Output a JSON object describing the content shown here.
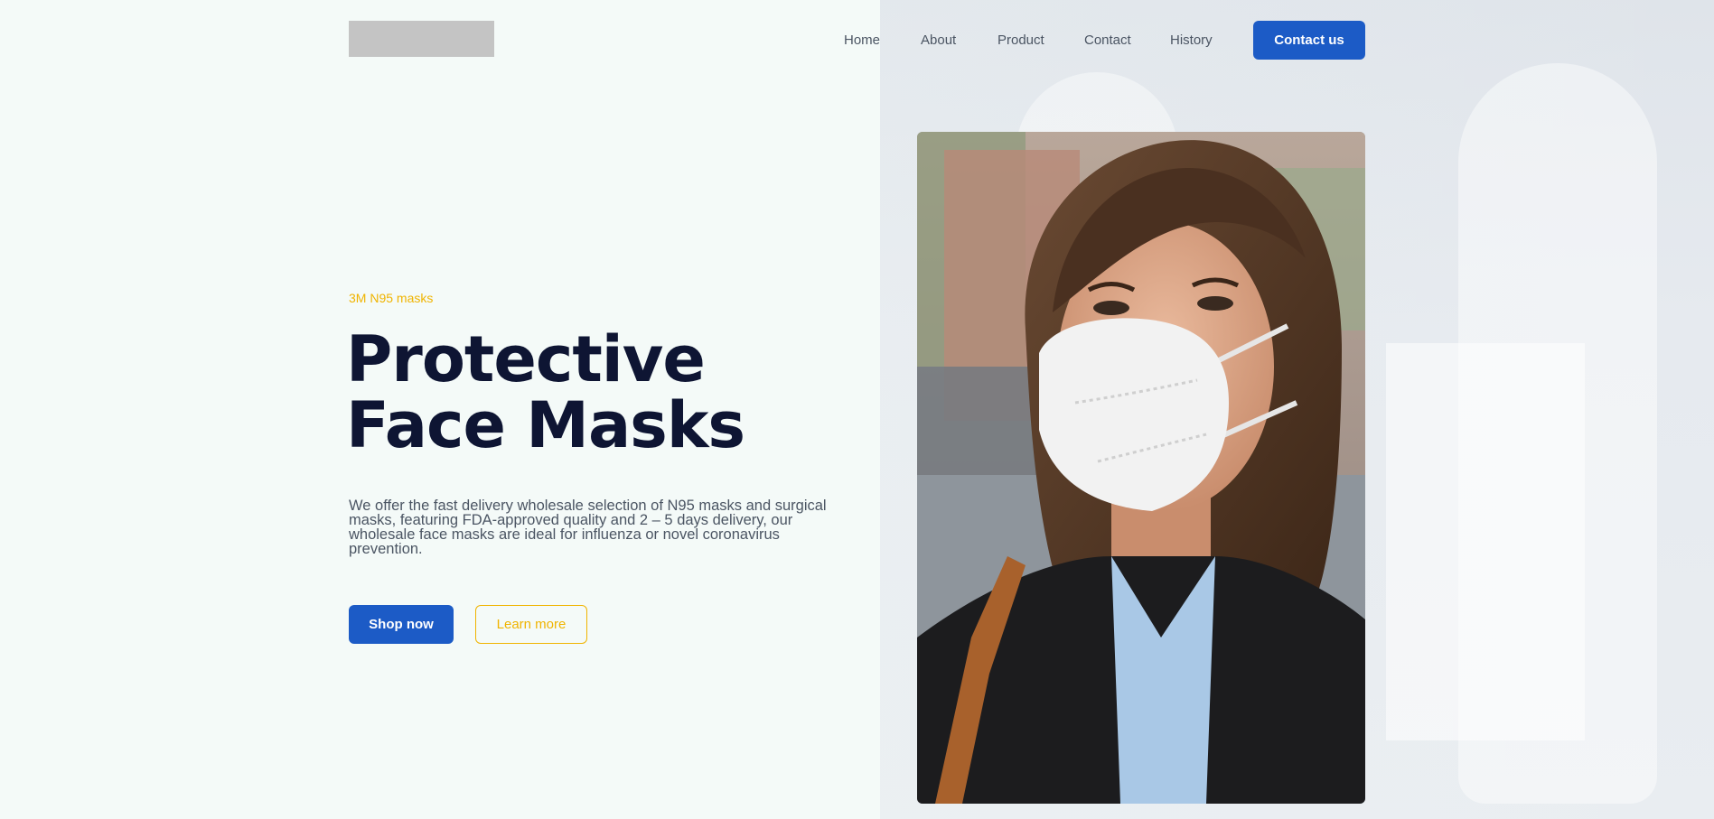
{
  "header": {
    "logo_alt": "",
    "nav": [
      "Home",
      "About",
      "Product",
      "Contact",
      "History"
    ],
    "cta_label": "Contact us"
  },
  "hero": {
    "eyebrow": "3M N95 masks",
    "title_line1": "Protective",
    "title_line2": "Face Masks",
    "description": "We offer the fast delivery wholesale selection of N95 masks and surgical masks, featuring FDA-approved quality and 2 – 5 days delivery, our wholesale face masks are ideal for influenza or novel coronavirus prevention.",
    "primary_button": "Shop now",
    "secondary_button": "Learn more",
    "image_subject": "woman-wearing-n95-mask-photo"
  },
  "colors": {
    "accent_blue": "#1c5bc6",
    "accent_yellow": "#f0b400",
    "heading": "#0e1533",
    "page_bg": "#f4faf8"
  }
}
